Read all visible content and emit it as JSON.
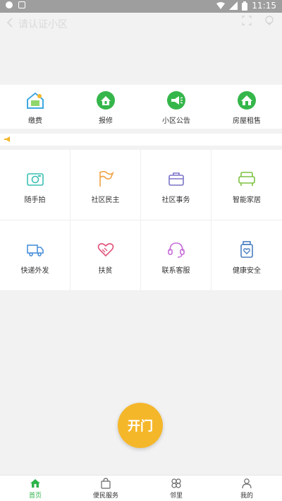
{
  "status_bar": {
    "time": "11:15"
  },
  "title_bar": {
    "title": "请认证小区"
  },
  "quick_actions": [
    {
      "label": "缴费",
      "icon": "payment-house-icon"
    },
    {
      "label": "报修",
      "icon": "repair-house-icon"
    },
    {
      "label": "小区公告",
      "icon": "announcement-megaphone-icon"
    },
    {
      "label": "房屋租售",
      "icon": "house-rent-icon"
    }
  ],
  "services": [
    {
      "label": "随手拍",
      "icon": "camera-icon"
    },
    {
      "label": "社区民主",
      "icon": "flag-icon"
    },
    {
      "label": "社区事务",
      "icon": "briefcase-icon"
    },
    {
      "label": "智能家居",
      "icon": "sofa-icon"
    },
    {
      "label": "快递外发",
      "icon": "truck-icon"
    },
    {
      "label": "扶贫",
      "icon": "heart-hands-icon"
    },
    {
      "label": "联系客服",
      "icon": "headset-icon"
    },
    {
      "label": "健康安全",
      "icon": "health-jar-icon"
    }
  ],
  "open_door": {
    "label": "开门"
  },
  "tabs": [
    {
      "label": "首页",
      "icon": "home-icon",
      "active": true
    },
    {
      "label": "便民服务",
      "icon": "shopping-bag-icon",
      "active": false
    },
    {
      "label": "邻里",
      "icon": "clover-icon",
      "active": false
    },
    {
      "label": "我的",
      "icon": "user-icon",
      "active": false
    }
  ],
  "colors": {
    "accent": "#2db34a",
    "open_button": "#f5b72a",
    "background": "#f2f2f2"
  }
}
